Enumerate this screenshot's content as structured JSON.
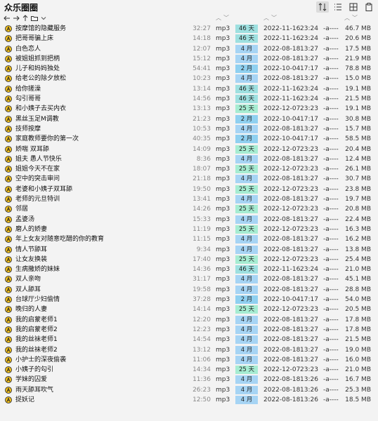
{
  "window": {
    "title": "众乐圈圈"
  },
  "colors": {
    "age_teal": "#9ee0e0",
    "age_blue": "#a6d4f4",
    "age_green": "#a6ecd2",
    "age_skyblue": "#8fd0f0",
    "icon_fill": "#f0c020",
    "icon_stroke": "#222222"
  },
  "toolbar": {
    "nav_icons": [
      "arrow-left-icon",
      "arrow-right-icon",
      "arrow-up-icon",
      "folder-icon",
      "chevron-down-icon"
    ],
    "right_icons": [
      "sort-icon",
      "list-view-icon",
      "grid-icon",
      "clipboard-icon"
    ]
  },
  "files": [
    {
      "name": "按摩馆的隐藏服务",
      "duration": "32:27",
      "format": "mp3",
      "age": "46 天",
      "age_color": "#9ee0e0",
      "date": "2022-11-16",
      "time": "23:24",
      "attr": "-a----",
      "size": "46.7 MB"
    },
    {
      "name": "把哥哥骗上床",
      "duration": "14:18",
      "format": "mp3",
      "age": "46 天",
      "age_color": "#9ee0e0",
      "date": "2022-11-16",
      "time": "23:24",
      "attr": "-a----",
      "size": "20.6 MB"
    },
    {
      "name": "白色恋人",
      "duration": "12:07",
      "format": "mp3",
      "age": "4 月",
      "age_color": "#a6d4f4",
      "date": "2022-08-18",
      "time": "13:27",
      "attr": "-a----",
      "size": "17.5 MB"
    },
    {
      "name": "被姐姐抓到把柄",
      "duration": "15:12",
      "format": "mp3",
      "age": "4 月",
      "age_color": "#a6d4f4",
      "date": "2022-08-18",
      "time": "13:27",
      "attr": "-a----",
      "size": "21.9 MB"
    },
    {
      "name": "儿子和妈妈独处",
      "duration": "54:41",
      "format": "mp3",
      "age": "2 月",
      "age_color": "#8fd0f0",
      "date": "2022-10-04",
      "time": "17:17",
      "attr": "-a----",
      "size": "78.8 MB"
    },
    {
      "name": "给老公的除夕放松",
      "duration": "10:23",
      "format": "mp3",
      "age": "4 月",
      "age_color": "#a6d4f4",
      "date": "2022-08-18",
      "time": "13:27",
      "attr": "-a----",
      "size": "15.0 MB"
    },
    {
      "name": "给你搓澡",
      "duration": "13:14",
      "format": "mp3",
      "age": "46 天",
      "age_color": "#9ee0e0",
      "date": "2022-11-16",
      "time": "23:24",
      "attr": "-a----",
      "size": "19.1 MB"
    },
    {
      "name": "勾引哥哥",
      "duration": "14:56",
      "format": "mp3",
      "age": "46 天",
      "age_color": "#9ee0e0",
      "date": "2022-11-16",
      "time": "23:24",
      "attr": "-a----",
      "size": "21.5 MB"
    },
    {
      "name": "和小姨子去买内衣",
      "duration": "13:13",
      "format": "mp3",
      "age": "25 天",
      "age_color": "#a6ecd2",
      "date": "2022-12-07",
      "time": "23:23",
      "attr": "-a----",
      "size": "19.1 MB"
    },
    {
      "name": "黑丝玉足M调教",
      "duration": "21:23",
      "format": "mp3",
      "age": "2 月",
      "age_color": "#8fd0f0",
      "date": "2022-10-04",
      "time": "17:17",
      "attr": "-a----",
      "size": "30.8 MB"
    },
    {
      "name": "技师按摩",
      "duration": "10:53",
      "format": "mp3",
      "age": "4 月",
      "age_color": "#a6d4f4",
      "date": "2022-08-18",
      "time": "13:27",
      "attr": "-a----",
      "size": "15.7 MB"
    },
    {
      "name": "家庭教师要你的第一次",
      "duration": "40:35",
      "format": "mp3",
      "age": "2 月",
      "age_color": "#8fd0f0",
      "date": "2022-10-04",
      "time": "17:17",
      "attr": "-a----",
      "size": "58.5 MB"
    },
    {
      "name": "娇喘 双耳舔",
      "duration": "14:09",
      "format": "mp3",
      "age": "25 天",
      "age_color": "#a6ecd2",
      "date": "2022-12-07",
      "time": "23:23",
      "attr": "-a----",
      "size": "20.4 MB"
    },
    {
      "name": "姐夫 愚人节快乐",
      "duration": "8:36",
      "format": "mp3",
      "age": "4 月",
      "age_color": "#a6d4f4",
      "date": "2022-08-18",
      "time": "13:27",
      "attr": "-a----",
      "size": "12.4 MB"
    },
    {
      "name": "姐姐今天不在家",
      "duration": "18:07",
      "format": "mp3",
      "age": "25 天",
      "age_color": "#a6ecd2",
      "date": "2022-12-07",
      "time": "23:23",
      "attr": "-a----",
      "size": "26.1 MB"
    },
    {
      "name": "空中的突击审问",
      "duration": "21:18",
      "format": "mp3",
      "age": "4 月",
      "age_color": "#a6d4f4",
      "date": "2022-08-18",
      "time": "13:27",
      "attr": "-a----",
      "size": "30.7 MB"
    },
    {
      "name": "老婆和小姨子双耳舔",
      "duration": "19:50",
      "format": "mp3",
      "age": "25 天",
      "age_color": "#a6ecd2",
      "date": "2022-12-07",
      "time": "23:23",
      "attr": "-a----",
      "size": "23.8 MB"
    },
    {
      "name": "老师的元旦特训",
      "duration": "13:41",
      "format": "mp3",
      "age": "4 月",
      "age_color": "#a6d4f4",
      "date": "2022-08-18",
      "time": "13:27",
      "attr": "-a----",
      "size": "19.7 MB"
    },
    {
      "name": "邻居",
      "duration": "14:26",
      "format": "mp3",
      "age": "25 天",
      "age_color": "#a6ecd2",
      "date": "2022-12-07",
      "time": "23:23",
      "attr": "-a----",
      "size": "20.8 MB"
    },
    {
      "name": "孟婆汤",
      "duration": "15:33",
      "format": "mp3",
      "age": "4 月",
      "age_color": "#a6d4f4",
      "date": "2022-08-18",
      "time": "13:27",
      "attr": "-a----",
      "size": "22.4 MB"
    },
    {
      "name": "磨人的娇妻",
      "duration": "11:19",
      "format": "mp3",
      "age": "25 天",
      "age_color": "#a6ecd2",
      "date": "2022-12-07",
      "time": "23:23",
      "attr": "-a----",
      "size": "16.3 MB"
    },
    {
      "name": "年上女友对随意吃醋的你的教育",
      "duration": "11:15",
      "format": "mp3",
      "age": "4 月",
      "age_color": "#a6d4f4",
      "date": "2022-08-18",
      "time": "13:27",
      "attr": "-a----",
      "size": "16.2 MB"
    },
    {
      "name": "情人节舔耳",
      "duration": "9:34",
      "format": "mp3",
      "age": "4 月",
      "age_color": "#a6d4f4",
      "date": "2022-08-18",
      "time": "13:27",
      "attr": "-a----",
      "size": "13.8 MB"
    },
    {
      "name": "让女友换装",
      "duration": "17:40",
      "format": "mp3",
      "age": "25 天",
      "age_color": "#a6ecd2",
      "date": "2022-12-07",
      "time": "23:23",
      "attr": "-a----",
      "size": "25.4 MB"
    },
    {
      "name": "生病撒娇的妹妹",
      "duration": "14:36",
      "format": "mp3",
      "age": "46 天",
      "age_color": "#9ee0e0",
      "date": "2022-11-16",
      "time": "23:24",
      "attr": "-a----",
      "size": "21.0 MB"
    },
    {
      "name": "双人亲吻",
      "duration": "31:17",
      "format": "mp3",
      "age": "4 月",
      "age_color": "#a6d4f4",
      "date": "2022-08-18",
      "time": "13:27",
      "attr": "-a----",
      "size": "45.1 MB"
    },
    {
      "name": "双人舔耳",
      "duration": "19:58",
      "format": "mp3",
      "age": "4 月",
      "age_color": "#a6d4f4",
      "date": "2022-08-18",
      "time": "13:27",
      "attr": "-a----",
      "size": "28.8 MB"
    },
    {
      "name": "台球厅少妇偷情",
      "duration": "37:28",
      "format": "mp3",
      "age": "2 月",
      "age_color": "#8fd0f0",
      "date": "2022-10-04",
      "time": "17:17",
      "attr": "-a----",
      "size": "54.0 MB"
    },
    {
      "name": "晚归的人妻",
      "duration": "14:14",
      "format": "mp3",
      "age": "25 天",
      "age_color": "#a6ecd2",
      "date": "2022-12-07",
      "time": "23:23",
      "attr": "-a----",
      "size": "20.5 MB"
    },
    {
      "name": "我的启蒙老师1",
      "duration": "12:20",
      "format": "mp3",
      "age": "4 月",
      "age_color": "#a6d4f4",
      "date": "2022-08-18",
      "time": "13:27",
      "attr": "-a----",
      "size": "17.8 MB"
    },
    {
      "name": "我的启蒙老师2",
      "duration": "12:23",
      "format": "mp3",
      "age": "4 月",
      "age_color": "#a6d4f4",
      "date": "2022-08-18",
      "time": "13:27",
      "attr": "-a----",
      "size": "17.8 MB"
    },
    {
      "name": "我的丝袜老师1",
      "duration": "14:54",
      "format": "mp3",
      "age": "4 月",
      "age_color": "#a6d4f4",
      "date": "2022-08-18",
      "time": "13:27",
      "attr": "-a----",
      "size": "21.5 MB"
    },
    {
      "name": "我的丝袜老师2",
      "duration": "13:12",
      "format": "mp3",
      "age": "4 月",
      "age_color": "#a6d4f4",
      "date": "2022-08-18",
      "time": "13:27",
      "attr": "-a----",
      "size": "19.0 MB"
    },
    {
      "name": "小护士的深夜偷袭",
      "duration": "11:06",
      "format": "mp3",
      "age": "4 月",
      "age_color": "#a6d4f4",
      "date": "2022-08-18",
      "time": "13:27",
      "attr": "-a----",
      "size": "16.0 MB"
    },
    {
      "name": "小姨子的勾引",
      "duration": "14:34",
      "format": "mp3",
      "age": "25 天",
      "age_color": "#a6ecd2",
      "date": "2022-12-07",
      "time": "23:23",
      "attr": "-a----",
      "size": "21.0 MB"
    },
    {
      "name": "学妹的囚爱",
      "duration": "11:36",
      "format": "mp3",
      "age": "4 月",
      "age_color": "#a6d4f4",
      "date": "2022-08-18",
      "time": "13:26",
      "attr": "-a----",
      "size": "16.7 MB"
    },
    {
      "name": "雨天舔耳吹气",
      "duration": "26:23",
      "format": "mp3",
      "age": "4 月",
      "age_color": "#a6d4f4",
      "date": "2022-08-18",
      "time": "13:26",
      "attr": "-a----",
      "size": "25.3 MB"
    },
    {
      "name": "捉妖记",
      "duration": "12:50",
      "format": "mp3",
      "age": "4 月",
      "age_color": "#a6d4f4",
      "date": "2022-08-18",
      "time": "13:26",
      "attr": "-a----",
      "size": "18.5 MB"
    }
  ]
}
